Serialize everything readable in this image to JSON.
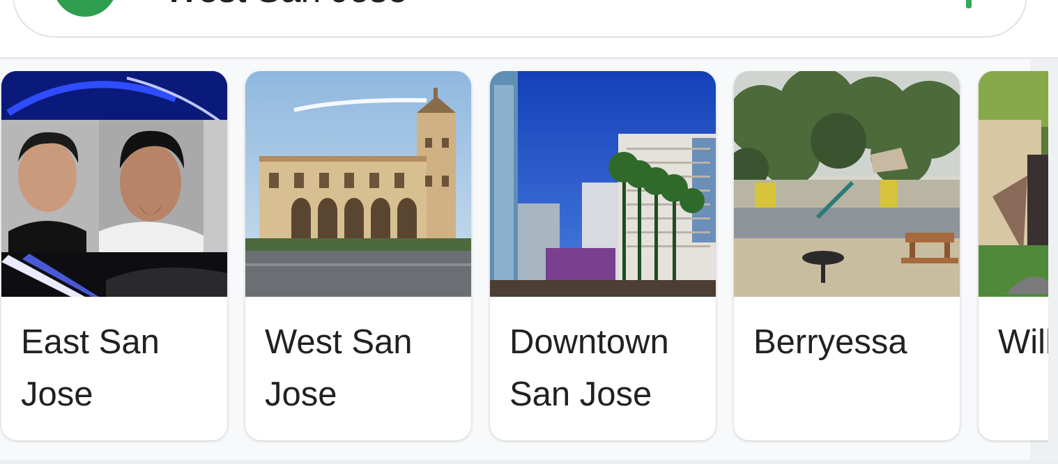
{
  "search": {
    "query": "West San Jose"
  },
  "carousel": {
    "items": [
      {
        "label": "East San Jose",
        "image": "mugshot-photo"
      },
      {
        "label": "West San Jose",
        "image": "historic-building-photo"
      },
      {
        "label": "Downtown San Jose",
        "image": "downtown-skyline-photo"
      },
      {
        "label": "Berryessa",
        "image": "park-playground-photo"
      },
      {
        "label": "Willow Glen",
        "image": "neighborhood-sign-photo"
      }
    ]
  },
  "colors": {
    "accent_green": "#34a853",
    "text": "#202124",
    "card_bg": "#ffffff",
    "panel_bg": "#f8f9fa"
  }
}
